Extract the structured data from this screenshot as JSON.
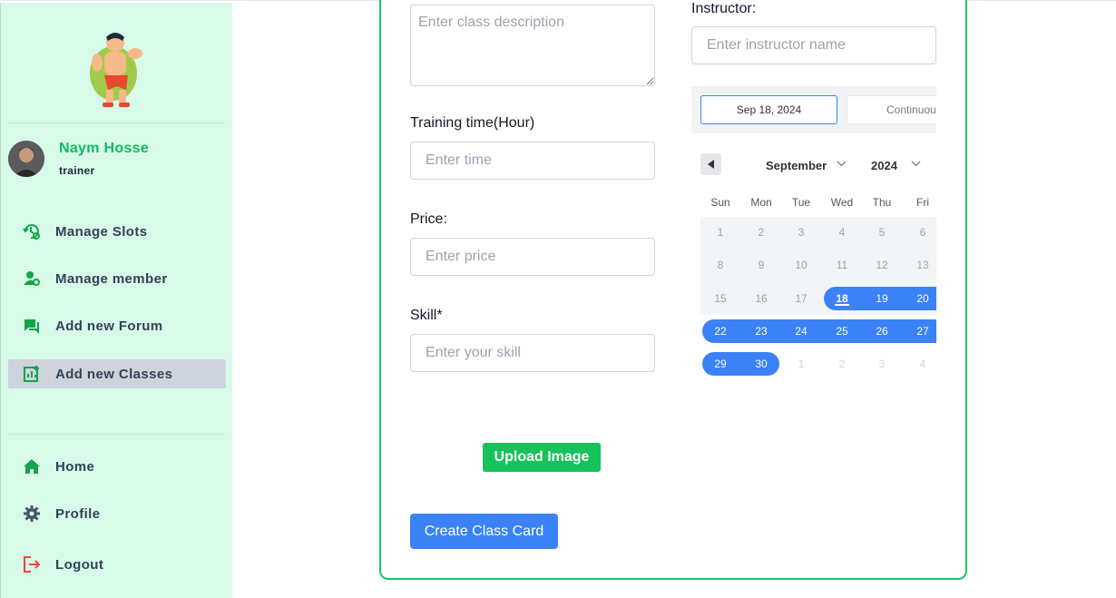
{
  "user": {
    "name": "Naym Hosse",
    "role": "trainer"
  },
  "nav": {
    "top": [
      {
        "label": "Manage Slots",
        "icon": "slot-settings-icon"
      },
      {
        "label": "Manage member",
        "icon": "member-settings-icon"
      },
      {
        "label": "Add new Forum",
        "icon": "forum-chat-icon"
      },
      {
        "label": "Add new Classes",
        "icon": "add-chart-icon",
        "active": true
      }
    ],
    "bottom": [
      {
        "label": "Home",
        "icon": "home-icon"
      },
      {
        "label": "Profile",
        "icon": "gear-icon"
      },
      {
        "label": "Logout",
        "icon": "logout-icon"
      }
    ]
  },
  "form": {
    "description_placeholder": "Enter class description",
    "training_time_label": "Training time(Hour)",
    "training_time_placeholder": "Enter time",
    "price_label": "Price:",
    "price_placeholder": "Enter price",
    "skill_label": "Skill*",
    "skill_placeholder": "Enter your skill",
    "instructor_label": "Instructor:",
    "instructor_placeholder": "Enter instructor name",
    "upload_label": "Upload Image",
    "create_label": "Create Class Card"
  },
  "datepicker": {
    "start_date": "Sep 18, 2024",
    "end_date": "Continuous",
    "month": "September",
    "year": "2024",
    "weekdays": [
      "Sun",
      "Mon",
      "Tue",
      "Wed",
      "Thu",
      "Fri"
    ],
    "weeks": [
      [
        "1",
        "2",
        "3",
        "4",
        "5",
        "6"
      ],
      [
        "8",
        "9",
        "10",
        "11",
        "12",
        "13"
      ],
      [
        "15",
        "16",
        "17",
        "18",
        "19",
        "20"
      ],
      [
        "22",
        "23",
        "24",
        "25",
        "26",
        "27"
      ],
      [
        "29",
        "30",
        "1",
        "2",
        "3",
        "4"
      ]
    ],
    "selected_from": "18",
    "selected_to": "30"
  },
  "colors": {
    "accent_green": "#10b866",
    "primary_blue": "#3b82f6",
    "sidebar_bg": "#d7fbe8"
  }
}
